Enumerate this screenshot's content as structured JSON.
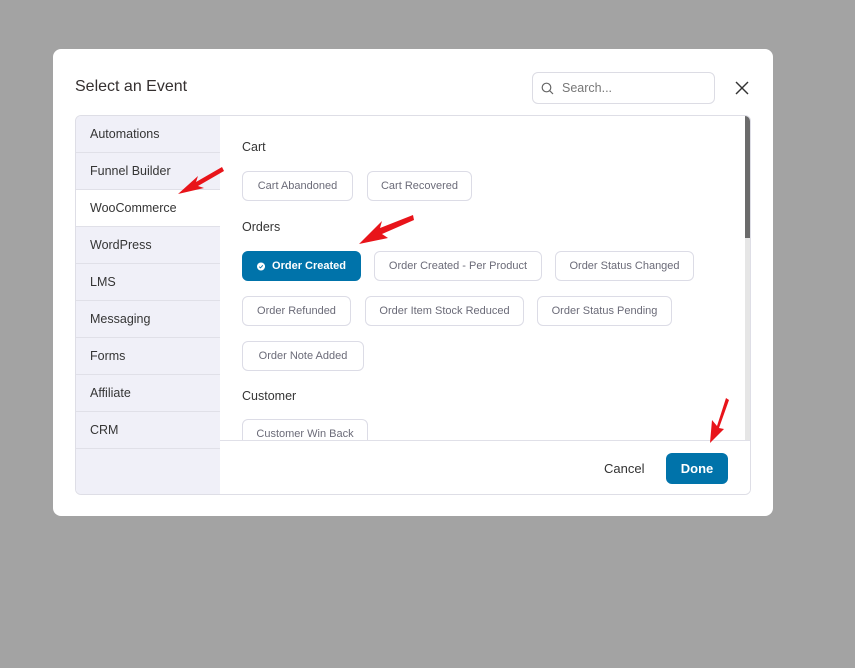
{
  "modal": {
    "title": "Select an Event",
    "search": {
      "placeholder": "Search...",
      "value": ""
    },
    "close_icon": "close-icon"
  },
  "sidebar": {
    "items": [
      {
        "label": "Automations",
        "active": false
      },
      {
        "label": "Funnel Builder",
        "active": false
      },
      {
        "label": "WooCommerce",
        "active": true
      },
      {
        "label": "WordPress",
        "active": false
      },
      {
        "label": "LMS",
        "active": false
      },
      {
        "label": "Messaging",
        "active": false
      },
      {
        "label": "Forms",
        "active": false
      },
      {
        "label": "Affiliate",
        "active": false
      },
      {
        "label": "CRM",
        "active": false
      }
    ]
  },
  "sections": [
    {
      "title": "Cart",
      "events": [
        {
          "label": "Cart Abandoned",
          "selected": false
        },
        {
          "label": "Cart Recovered",
          "selected": false
        }
      ]
    },
    {
      "title": "Orders",
      "events": [
        {
          "label": "Order Created",
          "selected": true
        },
        {
          "label": "Order Created - Per Product",
          "selected": false
        },
        {
          "label": "Order Status Changed",
          "selected": false
        },
        {
          "label": "Order Refunded",
          "selected": false
        },
        {
          "label": "Order Item Stock Reduced",
          "selected": false
        },
        {
          "label": "Order Status Pending",
          "selected": false
        },
        {
          "label": "Order Note Added",
          "selected": false
        }
      ]
    },
    {
      "title": "Customer",
      "events": [
        {
          "label": "Customer Win Back",
          "selected": false
        }
      ]
    }
  ],
  "footer": {
    "cancel_label": "Cancel",
    "done_label": "Done"
  },
  "colors": {
    "accent": "#0073aa",
    "overlay": "#a3a3a3",
    "sidebar_bg": "#f0f0f8",
    "annotation_arrow": "#e8141a"
  }
}
